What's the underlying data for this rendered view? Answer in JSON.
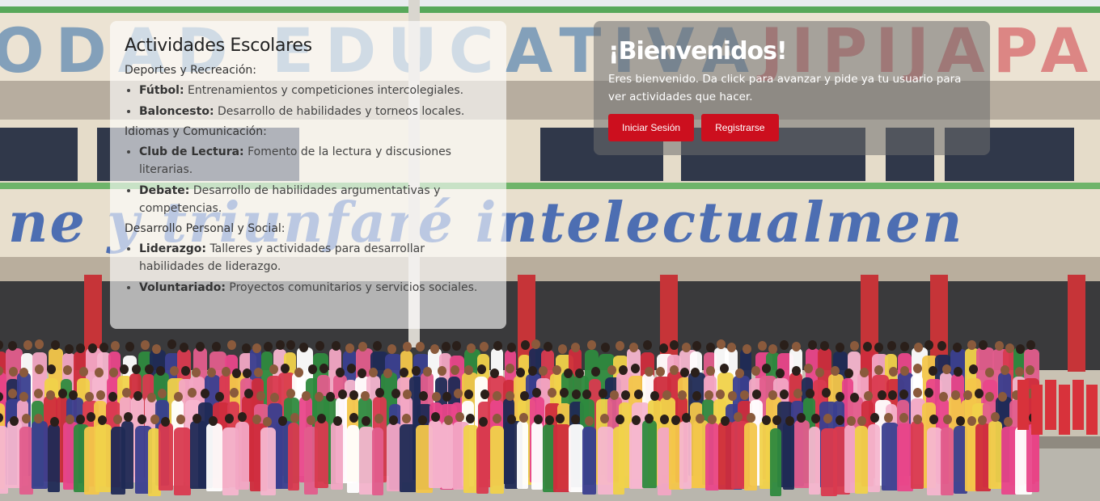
{
  "activities": {
    "title": "Actividades Escolares",
    "groups": [
      {
        "heading": "Deportes y Recreación:",
        "items": [
          {
            "name": "Fútbol:",
            "desc": "Entrenamientos y competiciones intercolegiales."
          },
          {
            "name": "Baloncesto:",
            "desc": "Desarrollo de habilidades y torneos locales."
          }
        ]
      },
      {
        "heading": "Idiomas y Comunicación:",
        "items": [
          {
            "name": "Club de Lectura:",
            "desc": "Fomento de la lectura y discusiones literarias."
          },
          {
            "name": "Debate:",
            "desc": "Desarrollo de habilidades argumentativas y competencias."
          }
        ]
      },
      {
        "heading": "Desarrollo Personal y Social:",
        "items": [
          {
            "name": "Liderazgo:",
            "desc": "Talleres y actividades para desarrollar habilidades de liderazgo."
          },
          {
            "name": "Voluntariado:",
            "desc": "Proyectos comunitarios y servicios sociales."
          }
        ]
      }
    ]
  },
  "welcome": {
    "title": "¡Bienvenidos!",
    "message": "Eres bienvenido. Da click para avanzar y pide ya tu usuario para ver actividades que hacer.",
    "login_label": "Iniciar Sesión",
    "register_label": "Registrarse"
  },
  "colors": {
    "primary_button": "#cc0f1e"
  }
}
